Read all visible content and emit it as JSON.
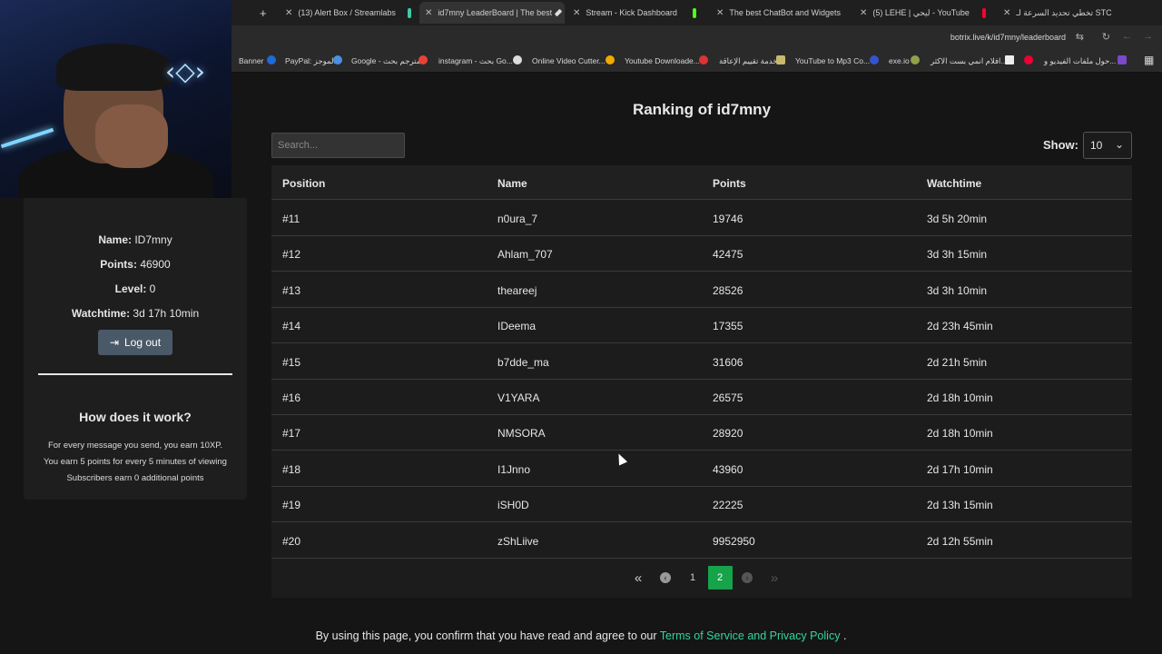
{
  "browser": {
    "tabs": [
      {
        "label": "+",
        "icon": "plus-icon"
      },
      {
        "label": "(13) Alert Box / Streamlabs",
        "icon": "streamlabs-icon"
      },
      {
        "label": "id7mny LeaderBoard | The best",
        "icon": "botrix-icon",
        "active": true
      },
      {
        "label": "Stream - Kick Dashboard",
        "icon": "kick-icon"
      },
      {
        "label": "The best ChatBot and Widgets",
        "icon": "botrix-icon"
      },
      {
        "label": "(5) LEHE | ليحي - YouTube",
        "icon": "youtube-icon"
      },
      {
        "label": "تخطي تحديد السرعة لـ STC",
        "icon": "globe-icon"
      }
    ],
    "url": "botrix.live/k/id7mny/leaderboard",
    "bookmarks": [
      "Banner",
      "PayPal: الموجز",
      "Google - مترجم بحث",
      "instagram - بحث Go...",
      "Online Video Cutter...",
      "Youtube Downloade...",
      "خدمة تقييم الإعاقة",
      "YouTube to Mp3 Co...",
      "exe.io",
      "افلام انمي بست الاكثر...",
      "حول ملفات الفيديو و..."
    ]
  },
  "sidebar": {
    "name_label": "Name:",
    "name_value": "ID7mny",
    "points_label": "Points:",
    "points_value": "46900",
    "level_label": "Level:",
    "level_value": "0",
    "watch_label": "Watchtime:",
    "watch_value": "3d 17h 10min",
    "logout_label": "Log out",
    "how_title": "How does it work?",
    "how_lines": [
      "For every message you send, you earn 10XP.",
      "You earn 5 points for every 5 minutes of viewing",
      "Subscribers earn 0 additional points"
    ]
  },
  "main": {
    "title": "Ranking of id7mny",
    "search_placeholder": "Search...",
    "show_label": "Show:",
    "show_value": "10",
    "columns": [
      "Position",
      "Name",
      "Points",
      "Watchtime"
    ],
    "rows": [
      [
        "#11",
        "n0ura_7",
        "19746",
        "3d 5h 20min"
      ],
      [
        "#12",
        "Ahlam_707",
        "42475",
        "3d 3h 15min"
      ],
      [
        "#13",
        "theareej",
        "28526",
        "3d 3h 10min"
      ],
      [
        "#14",
        "IDeema",
        "17355",
        "2d 23h 45min"
      ],
      [
        "#15",
        "b7dde_ma",
        "31606",
        "2d 21h 5min"
      ],
      [
        "#16",
        "V1YARA",
        "26575",
        "2d 18h 10min"
      ],
      [
        "#17",
        "NMSORA",
        "28920",
        "2d 18h 10min"
      ],
      [
        "#18",
        "I1Jnno",
        "43960",
        "2d 17h 10min"
      ],
      [
        "#19",
        "iSH0D",
        "22225",
        "2d 13h 15min"
      ],
      [
        "#20",
        "zShLiive",
        "9952950",
        "2d 12h 55min"
      ]
    ],
    "pagination": {
      "first": "«",
      "prev": "‹",
      "pages": [
        "1",
        "2"
      ],
      "current": "2",
      "next": "›",
      "last": "»"
    }
  },
  "footer": {
    "text": "By using this page, you confirm that you have read and agree to our",
    "link": "Terms of Service and Privacy Policy",
    "end": "."
  },
  "colors": {
    "accent": "#16a34a",
    "link": "#34d399",
    "background": "#151515"
  }
}
